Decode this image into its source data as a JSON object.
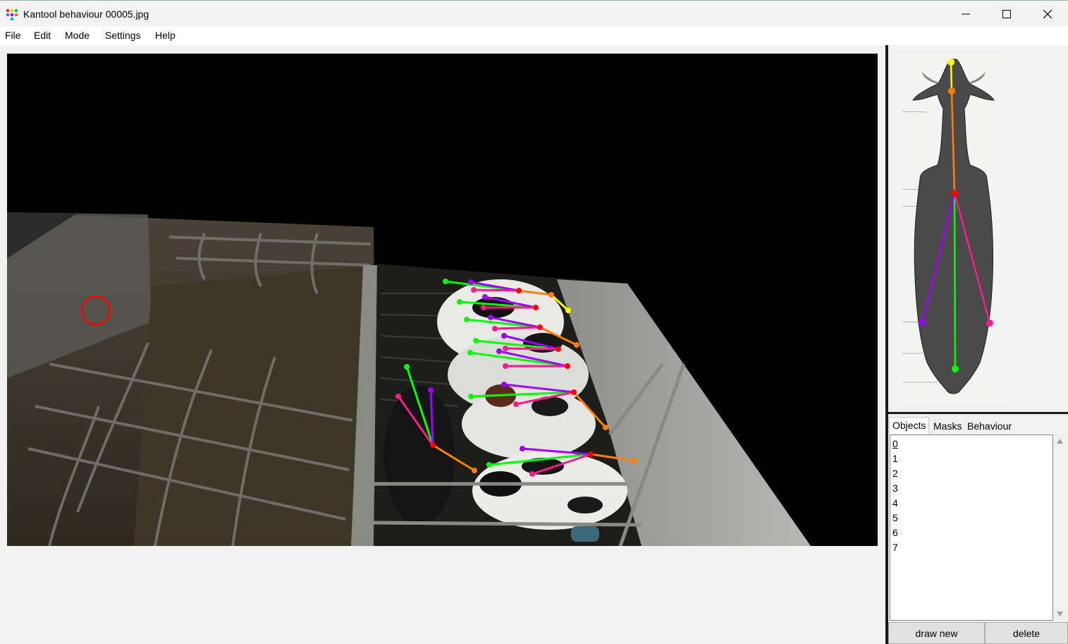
{
  "window": {
    "title": "Kantool behaviour 00005.jpg"
  },
  "menu": {
    "items": [
      "File",
      "Edit",
      "Mode",
      "Settings",
      "Help"
    ]
  },
  "tabs": [
    {
      "label": "Objects",
      "active": true
    },
    {
      "label": "Masks",
      "active": false
    },
    {
      "label": "Behaviour",
      "active": false
    }
  ],
  "objects": {
    "items": [
      "0",
      "1",
      "2",
      "3",
      "4",
      "5",
      "6",
      "7"
    ],
    "selected": "0"
  },
  "buttons": {
    "draw_new": "draw new",
    "delete": "delete"
  },
  "skeleton_colors": {
    "head": "#ffff00",
    "neck": "#ff8000",
    "spine": "#00ff00",
    "left": "#a000ff",
    "right": "#ff1a8c",
    "joint": "#ff0000"
  }
}
